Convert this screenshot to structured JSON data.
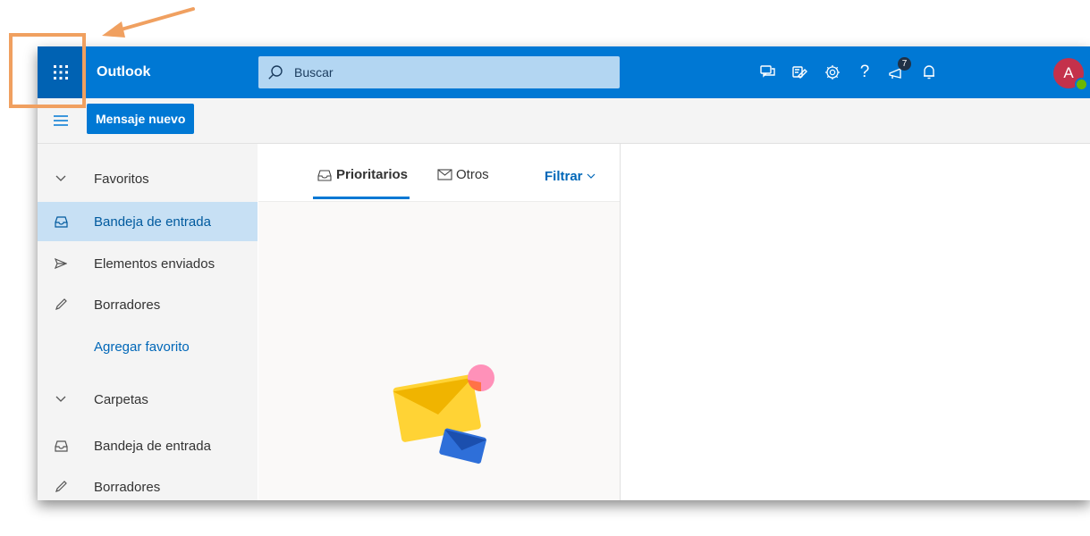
{
  "header": {
    "app_name": "Outlook",
    "search_placeholder": "Buscar",
    "notification_badge": "7",
    "avatar_initial": "A"
  },
  "commandbar": {
    "new_message_label": "Mensaje nuevo"
  },
  "nav": {
    "favorites_label": "Favoritos",
    "favorites": [
      {
        "label": "Bandeja de entrada",
        "icon": "inbox-icon",
        "selected": true
      },
      {
        "label": "Elementos enviados",
        "icon": "send-icon"
      },
      {
        "label": "Borradores",
        "icon": "pencil-icon"
      }
    ],
    "add_favorite_label": "Agregar favorito",
    "folders_label": "Carpetas",
    "folders": [
      {
        "label": "Bandeja de entrada",
        "icon": "inbox-icon"
      },
      {
        "label": "Borradores",
        "icon": "pencil-icon"
      }
    ]
  },
  "list": {
    "tab_focused": "Prioritarios",
    "tab_other": "Otros",
    "filter_label": "Filtrar"
  },
  "colors": {
    "accent": "#0078d4",
    "callout": "#f0a060"
  }
}
